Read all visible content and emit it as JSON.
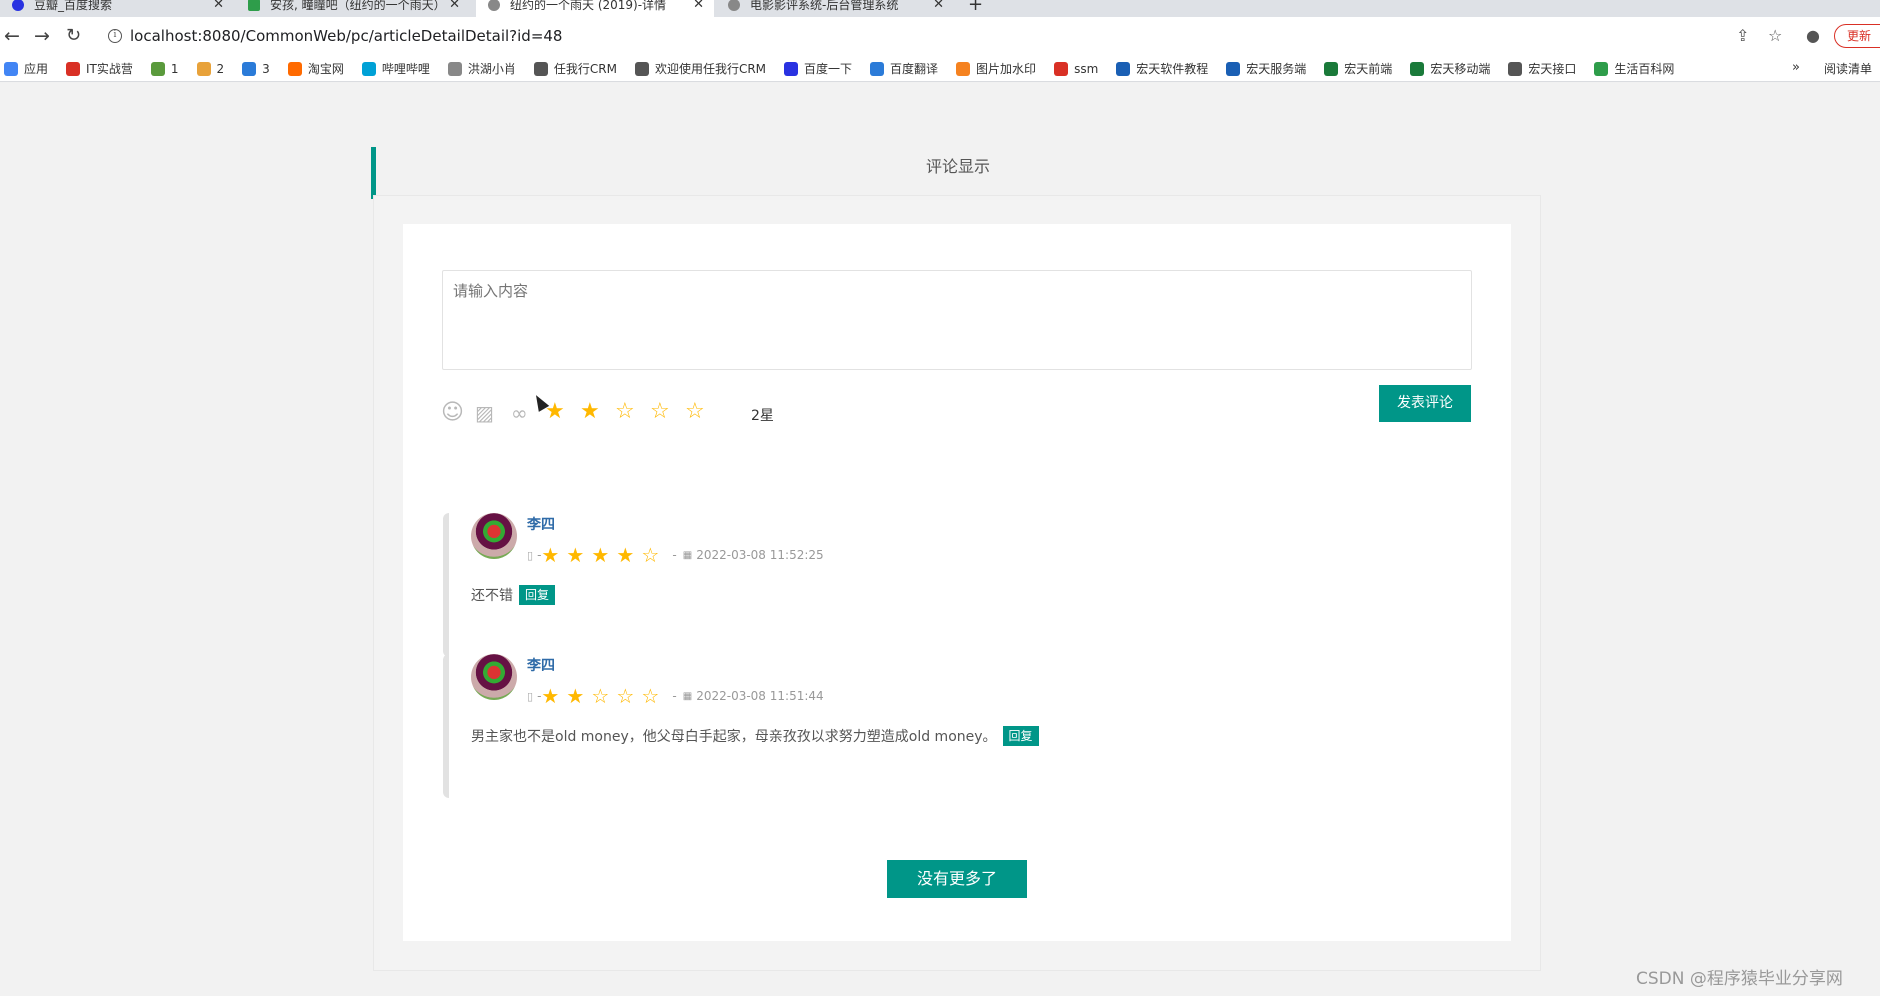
{
  "browser": {
    "tabs": [
      {
        "title": "豆瓣_百度搜索",
        "icon": "paw-icon",
        "active": false
      },
      {
        "title": "安孩, 疃瞳吧（纽约的一个雨天）",
        "icon": "doc-icon",
        "active": false
      },
      {
        "title": "纽约的一个雨天 (2019)-详情",
        "icon": "globe-icon",
        "active": true
      },
      {
        "title": "电影影评系统-后台管理系统",
        "icon": "globe-icon",
        "active": false
      }
    ],
    "new_tab_symbol": "+",
    "url": "localhost:8080/CommonWeb/pc/articleDetailDetail?id=48",
    "update_label": "更新",
    "bookmarks": [
      {
        "label": "应用",
        "color": "#4285f4"
      },
      {
        "label": "IT实战营",
        "color": "#d93025"
      },
      {
        "label": "1",
        "color": "#5a9a3c"
      },
      {
        "label": "2",
        "color": "#e8a23a"
      },
      {
        "label": "3",
        "color": "#2b7bd8"
      },
      {
        "label": "淘宝网",
        "color": "#ff6a00"
      },
      {
        "label": "哔哩哔哩",
        "color": "#00a1d6"
      },
      {
        "label": "洪湖小肖",
        "color": "#888888"
      },
      {
        "label": "任我行CRM",
        "color": "#555555"
      },
      {
        "label": "欢迎使用任我行CRM",
        "color": "#555555"
      },
      {
        "label": "百度一下",
        "color": "#2932e1"
      },
      {
        "label": "百度翻译",
        "color": "#2b7bd8"
      },
      {
        "label": "图片加水印",
        "color": "#f58220"
      },
      {
        "label": "ssm",
        "color": "#d93025"
      },
      {
        "label": "宏天软件教程",
        "color": "#1a5fb4"
      },
      {
        "label": "宏天服务端",
        "color": "#1a5fb4"
      },
      {
        "label": "宏天前端",
        "color": "#1a7a3a"
      },
      {
        "label": "宏天移动端",
        "color": "#1a7a3a"
      },
      {
        "label": "宏天接口",
        "color": "#555555"
      },
      {
        "label": "生活百科网",
        "color": "#2e9d4a"
      }
    ],
    "bookmarks_more": "»",
    "reading_list": "阅读清单"
  },
  "section": {
    "title": "评论显示",
    "accent_color": "#009688"
  },
  "composer": {
    "placeholder": "请输入内容",
    "tools": [
      "smile-icon",
      "image-icon",
      "link-icon"
    ],
    "rating_value": 2,
    "rating_max": 5,
    "rating_text": "2星",
    "submit_label": "发表评论"
  },
  "comments": [
    {
      "author": "李四",
      "rating": 4,
      "rating_max": 5,
      "separator": "-",
      "timestamp": "2022-03-08 11:52:25",
      "content": "还不错",
      "reply_label": "回复"
    },
    {
      "author": "李四",
      "rating": 2,
      "rating_max": 5,
      "separator": "-",
      "timestamp": "2022-03-08 11:51:44",
      "content": "男主家也不是old money，他父母白手起家，母亲孜孜以求努力塑造成old money。",
      "reply_label": "回复"
    }
  ],
  "no_more_label": "没有更多了",
  "watermark": "CSDN @程序猿毕业分享网"
}
